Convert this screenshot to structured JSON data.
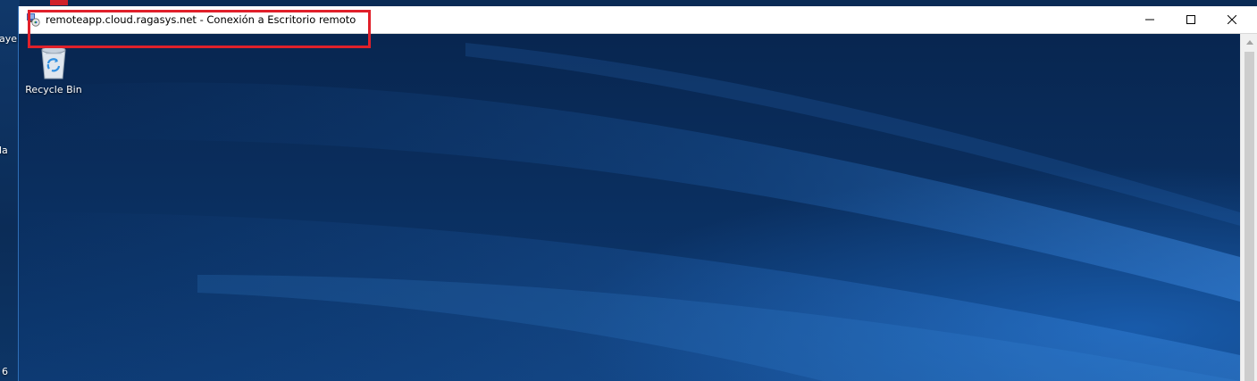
{
  "host_desktop": {
    "labels": [
      "ayer",
      "la",
      "6"
    ]
  },
  "window": {
    "title": "remoteapp.cloud.ragasys.net - Conexión a Escritorio remoto",
    "icon": "remote-desktop-icon",
    "controls": {
      "minimize": "minimize-icon",
      "maximize": "maximize-icon",
      "close": "close-icon"
    }
  },
  "remote_desktop": {
    "icons": [
      {
        "label": "Recycle Bin",
        "icon": "recycle-bin-icon"
      }
    ]
  },
  "colors": {
    "highlight": "#e0202a",
    "desktop_blue": "#0a2e5e",
    "titlebar": "#ffffff"
  }
}
